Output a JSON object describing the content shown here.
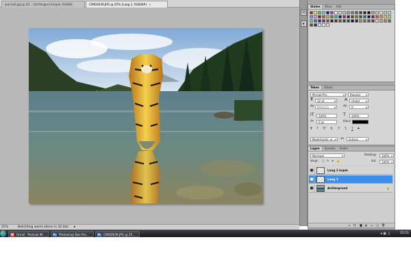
{
  "doc_tabs": [
    {
      "label": "ipar1a6.jpg @ 25... (Achtergrond kopie, RGB/8)"
    },
    {
      "label": "CIMG0039.JPG @ 25% (Laag 1, RGB/8#)",
      "active": true
    }
  ],
  "status_bar": {
    "zoom": "25%",
    "info": "Belichting werkt alleen in 32 bits"
  },
  "swatches_panel": {
    "tabs": [
      "Stalen",
      "Kleur",
      "Info"
    ],
    "colors": [
      "#ff0000",
      "#ffff00",
      "#00ff00",
      "#00ffff",
      "#0000ff",
      "#ff00ff",
      "#ffffff",
      "#e0e0e0",
      "#c0c0c0",
      "#a0a0a0",
      "#808080",
      "#606060",
      "#404040",
      "#202020",
      "#000000",
      "#ff8080",
      "#ffc080",
      "#ffff80",
      "#80ff80",
      "#80ffff",
      "#8080ff",
      "#ff80ff",
      "#c00000",
      "#c06000",
      "#c0c000",
      "#00c000",
      "#00c0c0",
      "#0000c0",
      "#c000c0",
      "#800000",
      "#804000",
      "#808000",
      "#008000",
      "#008080",
      "#000080",
      "#800080",
      "#ff4000",
      "#ff8000",
      "#ffc000",
      "#80ff00",
      "#00ff80",
      "#0080ff",
      "#4000ff",
      "#8000ff",
      "#ff0080",
      "#600000",
      "#603000",
      "#606000",
      "#006000",
      "#006060",
      "#000060",
      "#600060",
      "#c08040",
      "#a06030",
      "#805020",
      "#604010",
      "#f0d0b0",
      "#d0a080",
      "#b08060",
      "#906040",
      "#704020",
      "#502010",
      "#ffe0e0",
      "#e0ffe0",
      "#e0e0ff"
    ]
  },
  "character_panel": {
    "tabs": [
      "Teken",
      "Alinea"
    ],
    "font_family": "Myriad Pro",
    "font_style": "Regular",
    "font_size": "12 pt",
    "leading": "(Auto)",
    "kerning": "Metrisch",
    "tracking": "0",
    "vertical_scale": "100%",
    "horizontal_scale": "100%",
    "baseline_shift": "0 pt",
    "color_label": "Kleur:",
    "style_buttons": [
      "T",
      "T",
      "TT",
      "Tr",
      "T'",
      "T,",
      "T",
      "T"
    ],
    "language": "Nederlands: ni...",
    "antialias": "Scherp"
  },
  "layers_panel": {
    "tabs": [
      "Lagen",
      "Kanalen",
      "Paden"
    ],
    "blend_mode": "Normaal",
    "opacity_label": "Dekking:",
    "opacity": "100%",
    "lock_label": "Vergr.:",
    "fill_label": "Vul:",
    "fill": "100%",
    "layers": [
      {
        "name": "Laag 1 kopie",
        "selected": false
      },
      {
        "name": "Laag 1",
        "selected": true
      },
      {
        "name": "Achtergrond",
        "selected": false
      }
    ]
  },
  "taskbar": {
    "buttons": [
      {
        "label": "Gmail - Postvak IN - ...",
        "icon": "gmail-icon",
        "color": "#d44638"
      },
      {
        "label": "Photoshop Doe Pro...",
        "icon": "photoshop-icon",
        "color": "#1c5fa8"
      },
      {
        "label": "CIMG0039.JPG @ 25...",
        "icon": "photoshop-icon",
        "color": "#1c5fa8"
      }
    ],
    "clock": "15:51"
  }
}
